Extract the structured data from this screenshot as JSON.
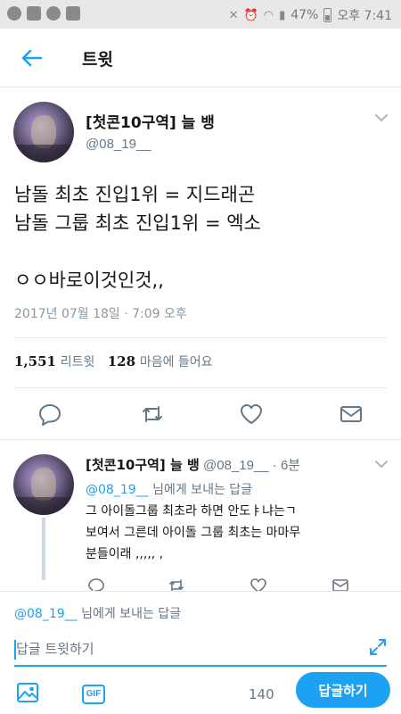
{
  "status_bar": {
    "battery": "47%",
    "time": "오후 7:41"
  },
  "header": {
    "title": "트윗"
  },
  "tweet": {
    "name": "[첫콘10구역] 늘 뱅",
    "handle": "@08_19__",
    "text": "남돌 최초 진입1위 = 지드래곤\n남돌 그룹 최초 진입1위 = 엑소\n\nㅇㅇ바로이것인것,,",
    "timestamp": "2017년 07월 18일 · 7:09 오후",
    "retweets_count": "1,551",
    "retweets_label": "리트윗",
    "likes_count": "128",
    "likes_label": "마음에 들어요"
  },
  "reply": {
    "name": "[첫콘10구역] 늘 뱅",
    "meta": "@08_19__ · 6분",
    "replying_to_handle": "@08_19__",
    "replying_to_suffix": "님에게 보내는 답글",
    "text": "그 아이돌그룹 최초라 하면 안도ㅑ냐는ㄱ\n보여서 그른데 아이돌 그룹 최초는 마마무\n분들이래 ,,,,, ,"
  },
  "compose": {
    "replying_to_handle": "@08_19__",
    "replying_to_suffix": "님에게 보내는 답글",
    "placeholder": "답글 트윗하기",
    "gif_label": "GIF",
    "char_count": "140",
    "submit_label": "답글하기"
  },
  "colors": {
    "accent": "#1da1f2",
    "text": "#14171a",
    "muted": "#657786",
    "divider": "#e1e8ed"
  },
  "icons": [
    "back-arrow-icon",
    "chevron-down-icon",
    "reply-icon",
    "retweet-icon",
    "like-icon",
    "message-icon",
    "image-icon",
    "gif-icon",
    "expand-icon"
  ]
}
